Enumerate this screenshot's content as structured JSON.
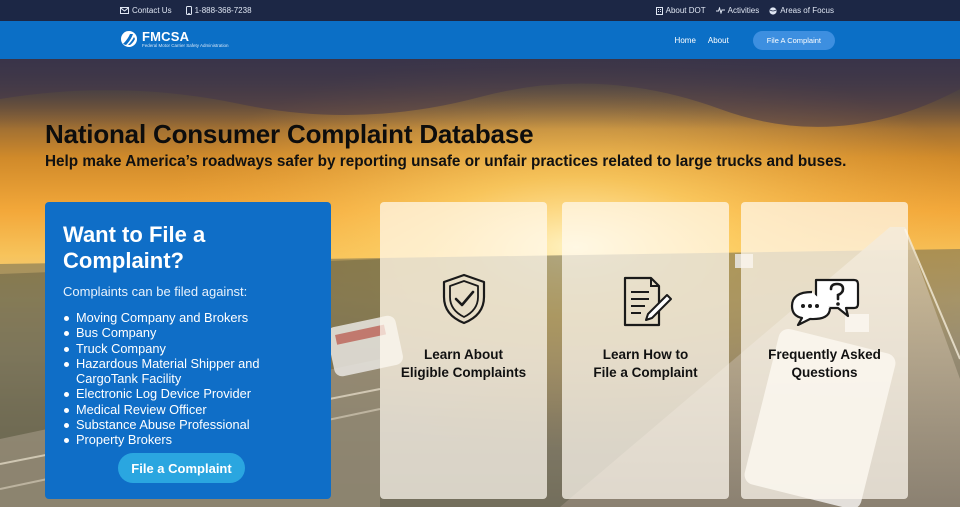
{
  "topbar": {
    "contact_label": "Contact Us",
    "phone_label": "1-888-368-7238",
    "about_dot_label": "About DOT",
    "activities_label": "Activities",
    "areas_label": "Areas of Focus"
  },
  "nav": {
    "logo_name": "FMCSA",
    "logo_sub": "Federal Motor Carrier Safety Administration",
    "home": "Home",
    "about": "About",
    "cta": "File A Complaint"
  },
  "hero": {
    "title": "National Consumer Complaint Database",
    "tagline": "Help make America’s roadways safer by reporting unsafe or unfair practices related to large trucks and buses."
  },
  "panel": {
    "heading": "Want to File a Complaint?",
    "intro": "Complaints can be filed against:",
    "items": [
      "Moving Company and Brokers",
      "Bus Company",
      "Truck Company",
      "Hazardous Material Shipper and CargoTank Facility",
      "Electronic Log Device Provider",
      "Medical Review Officer",
      "Substance Abuse Professional",
      "Property Brokers"
    ],
    "button": "File a Complaint"
  },
  "cards": [
    {
      "line1": "Learn About",
      "line2": "Eligible Complaints",
      "icon": "shield-check-icon"
    },
    {
      "line1": "Learn How to",
      "line2": "File a Complaint",
      "icon": "document-pen-icon"
    },
    {
      "line1": "Frequently Asked",
      "line2": "Questions",
      "icon": "question-bubbles-icon"
    }
  ],
  "colors": {
    "topbar": "#1c2745",
    "navbar": "#0b6fc6",
    "panel": "#0f6ec7",
    "panel_button": "#2aa6e0",
    "nav_cta": "#3d8fe0"
  }
}
